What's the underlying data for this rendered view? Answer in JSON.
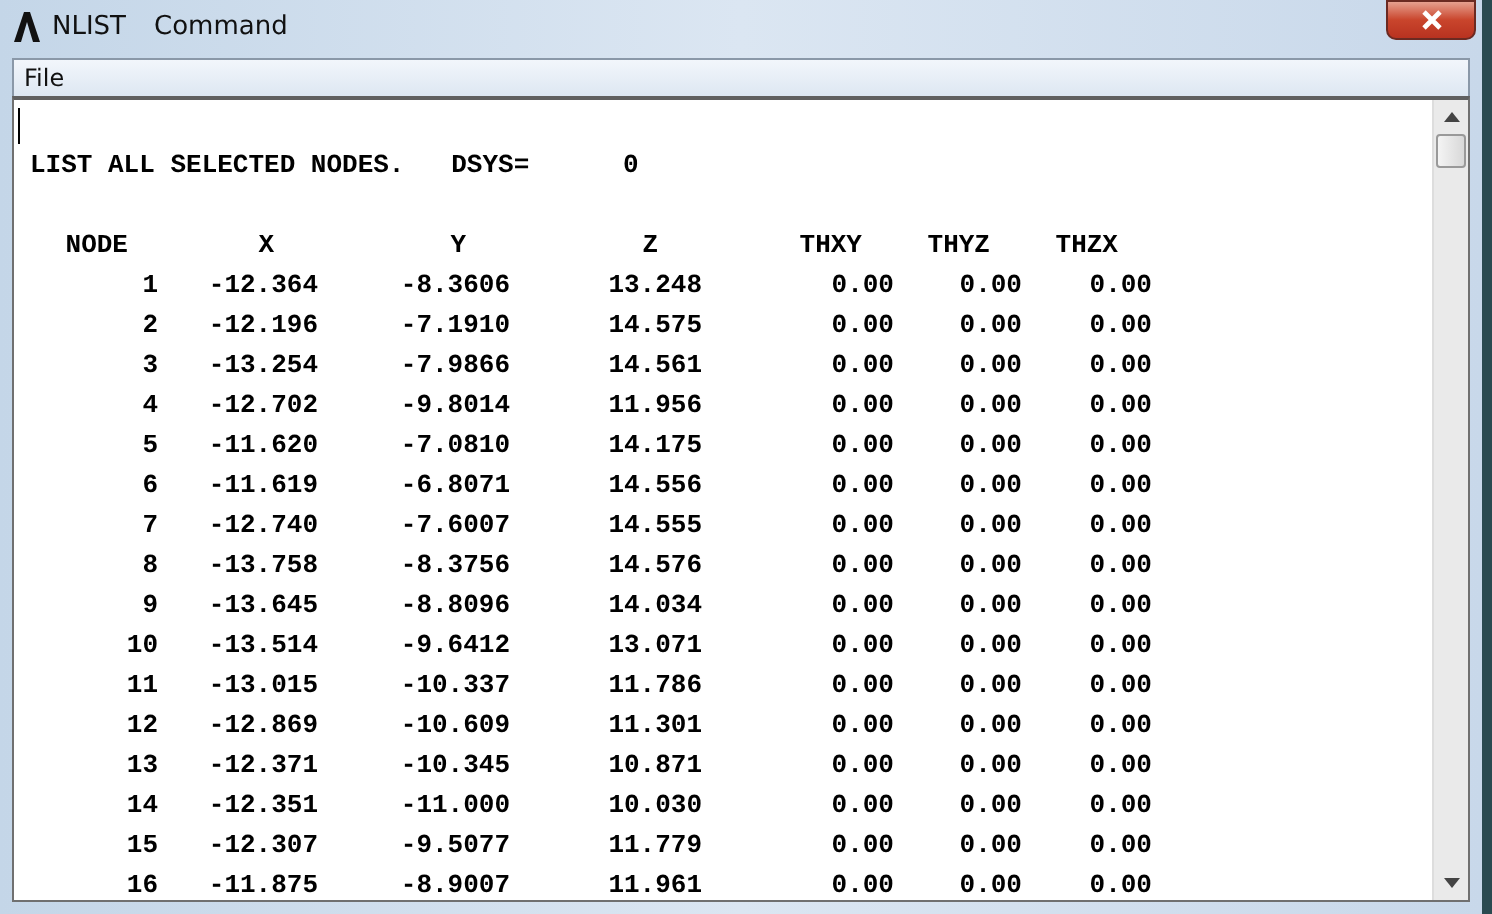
{
  "window": {
    "app_name": "NLIST",
    "title": "Command"
  },
  "menu": [
    "File"
  ],
  "listing": {
    "heading": "LIST ALL SELECTED NODES.   DSYS=      0",
    "columns": [
      "NODE",
      "X",
      "Y",
      "Z",
      "THXY",
      "THYZ",
      "THZX"
    ],
    "rows": [
      [
        "1",
        "-12.364",
        "-8.3606",
        "13.248",
        "0.00",
        "0.00",
        "0.00"
      ],
      [
        "2",
        "-12.196",
        "-7.1910",
        "14.575",
        "0.00",
        "0.00",
        "0.00"
      ],
      [
        "3",
        "-13.254",
        "-7.9866",
        "14.561",
        "0.00",
        "0.00",
        "0.00"
      ],
      [
        "4",
        "-12.702",
        "-9.8014",
        "11.956",
        "0.00",
        "0.00",
        "0.00"
      ],
      [
        "5",
        "-11.620",
        "-7.0810",
        "14.175",
        "0.00",
        "0.00",
        "0.00"
      ],
      [
        "6",
        "-11.619",
        "-6.8071",
        "14.556",
        "0.00",
        "0.00",
        "0.00"
      ],
      [
        "7",
        "-12.740",
        "-7.6007",
        "14.555",
        "0.00",
        "0.00",
        "0.00"
      ],
      [
        "8",
        "-13.758",
        "-8.3756",
        "14.576",
        "0.00",
        "0.00",
        "0.00"
      ],
      [
        "9",
        "-13.645",
        "-8.8096",
        "14.034",
        "0.00",
        "0.00",
        "0.00"
      ],
      [
        "10",
        "-13.514",
        "-9.6412",
        "13.071",
        "0.00",
        "0.00",
        "0.00"
      ],
      [
        "11",
        "-13.015",
        "-10.337",
        "11.786",
        "0.00",
        "0.00",
        "0.00"
      ],
      [
        "12",
        "-12.869",
        "-10.609",
        "11.301",
        "0.00",
        "0.00",
        "0.00"
      ],
      [
        "13",
        "-12.371",
        "-10.345",
        "10.871",
        "0.00",
        "0.00",
        "0.00"
      ],
      [
        "14",
        "-12.351",
        "-11.000",
        "10.030",
        "0.00",
        "0.00",
        "0.00"
      ],
      [
        "15",
        "-12.307",
        "-9.5077",
        "11.779",
        "0.00",
        "0.00",
        "0.00"
      ],
      [
        "16",
        "-11.875",
        "-8.9007",
        "11.961",
        "0.00",
        "0.00",
        "0.00"
      ]
    ]
  }
}
